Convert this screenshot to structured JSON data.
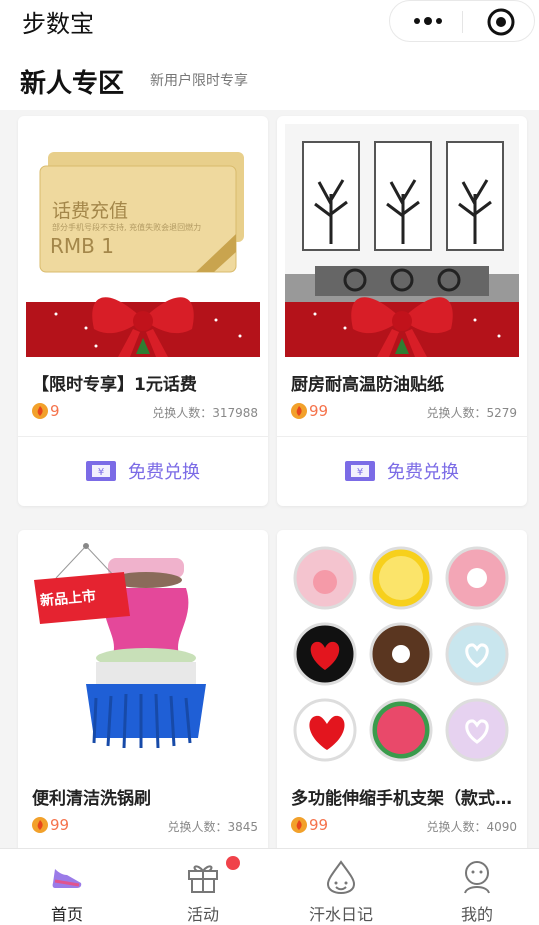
{
  "header": {
    "title": "步数宝"
  },
  "section": {
    "title": "新人专区",
    "subtitle": "新用户限时专享"
  },
  "products": [
    {
      "name": "【限时专享】1元话费",
      "price": "9",
      "redeem_count": "兑换人数：317988",
      "button": "免费兑换",
      "image_text": {
        "card_title": "话费充值",
        "card_note": "部分手机号段不支持, 充值失败会退回燃力",
        "card_amount": "RMB 1"
      }
    },
    {
      "name": "厨房耐高温防油贴纸",
      "price": "99",
      "redeem_count": "兑换人数：5279",
      "button": "免费兑换"
    },
    {
      "name": "便利清洁洗锅刷",
      "price": "99",
      "redeem_count": "兑换人数：3845",
      "badge": "新品上市"
    },
    {
      "name": "多功能伸缩手机支架（款式随机）",
      "price": "99",
      "redeem_count": "兑换人数：4090"
    }
  ],
  "tabs": [
    {
      "label": "首页",
      "icon": "shoe-icon",
      "active": true
    },
    {
      "label": "活动",
      "icon": "gift-icon",
      "has_badge": true
    },
    {
      "label": "汗水日记",
      "icon": "sweat-drop-icon"
    },
    {
      "label": "我的",
      "icon": "user-icon"
    }
  ],
  "colors": {
    "accent": "#7b6be6",
    "price": "#f5734c",
    "badge": "#f0424a"
  }
}
